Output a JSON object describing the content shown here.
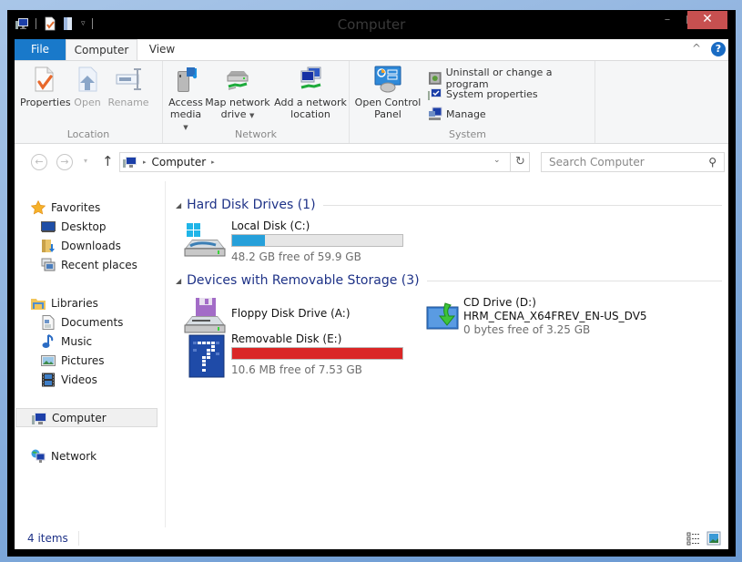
{
  "window": {
    "title": "Computer",
    "controls": {
      "minimize": "–",
      "maximize": "",
      "close": "✕"
    }
  },
  "quick_access": {
    "icons": [
      "computer-icon",
      "properties-icon",
      "new-folder-icon"
    ],
    "customize": "▿"
  },
  "tabs": [
    {
      "label": "File",
      "active": false
    },
    {
      "label": "Computer",
      "active": true
    },
    {
      "label": "View",
      "active": false
    }
  ],
  "ribbon": {
    "collapse_glyph": "^",
    "help_glyph": "?",
    "groups": {
      "location": {
        "label": "Location",
        "buttons": [
          {
            "label": "Properties",
            "enabled": true
          },
          {
            "label": "Open",
            "enabled": false
          },
          {
            "label": "Rename",
            "enabled": false
          }
        ]
      },
      "network": {
        "label": "Network",
        "buttons": [
          {
            "label_line1": "Access",
            "label_line2": "media",
            "dropdown": true
          },
          {
            "label_line1": "Map network",
            "label_line2": "drive",
            "dropdown": true
          },
          {
            "label_line1": "Add a network",
            "label_line2": "location",
            "dropdown": false
          }
        ]
      },
      "system": {
        "label": "System",
        "large_button": {
          "label_line1": "Open Control",
          "label_line2": "Panel"
        },
        "small_buttons": [
          {
            "label": "Uninstall or change a program"
          },
          {
            "label": "System properties"
          },
          {
            "label": "Manage"
          }
        ]
      }
    }
  },
  "navigation": {
    "back": "←",
    "forward": "→",
    "recent": "▾",
    "up": "↑",
    "address": {
      "crumbs": [
        "Computer"
      ],
      "separator": "▸"
    },
    "address_dropdown": "⌄",
    "refresh": "↻",
    "search": {
      "placeholder": "Search Computer",
      "value": ""
    }
  },
  "nav_pane": {
    "favorites": {
      "label": "Favorites",
      "items": [
        {
          "label": "Desktop"
        },
        {
          "label": "Downloads"
        },
        {
          "label": "Recent places"
        }
      ]
    },
    "libraries": {
      "label": "Libraries",
      "items": [
        {
          "label": "Documents"
        },
        {
          "label": "Music"
        },
        {
          "label": "Pictures"
        },
        {
          "label": "Videos"
        }
      ]
    },
    "computer": {
      "label": "Computer",
      "selected": true
    },
    "network": {
      "label": "Network"
    }
  },
  "content": {
    "groups": [
      {
        "title": "Hard Disk Drives (1)",
        "drives": [
          {
            "name": "Local Disk (C:)",
            "free_text": "48.2 GB free of 59.9 GB",
            "used_fraction": 0.195,
            "bar_color": "#26a0da"
          }
        ]
      },
      {
        "title": "Devices with Removable Storage (3)",
        "drives": [
          {
            "name": "Floppy Disk Drive (A:)"
          },
          {
            "name": "CD Drive (D:)",
            "label": "HRM_CENA_X64FREV_EN-US_DV5",
            "free_text": "0 bytes free of 3.25 GB"
          },
          {
            "name": "Removable Disk (E:)",
            "free_text": "10.6 MB free of 7.53 GB",
            "used_fraction": 0.9986,
            "bar_color": "#da2626"
          }
        ]
      }
    ]
  },
  "status": {
    "item_count": "4 items"
  },
  "colors": {
    "file_tab": "#1979ca",
    "close_button": "#c75050",
    "group_heading": "#1e3287",
    "bar_normal": "#26a0da",
    "bar_full": "#da2626"
  }
}
